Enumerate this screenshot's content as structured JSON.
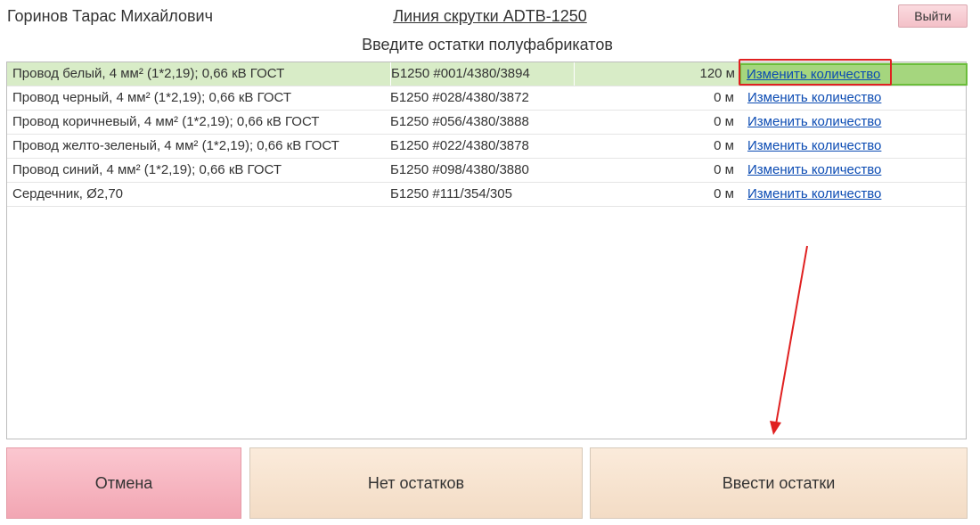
{
  "header": {
    "user_name": "Горинов Тарас Михайлович",
    "line_title": "Линия скрутки ADTB-1250",
    "logout_label": "Выйти"
  },
  "subtitle": "Введите остатки полуфабрикатов",
  "items": [
    {
      "name": "Провод белый, 4 мм² (1*2,19); 0,66 кВ ГОСТ",
      "code": "Б1250 #001/4380/3894",
      "qty": "120 м",
      "action": "Изменить количество",
      "selected": true
    },
    {
      "name": "Провод черный, 4 мм² (1*2,19); 0,66 кВ ГОСТ",
      "code": "Б1250 #028/4380/3872",
      "qty": "0 м",
      "action": "Изменить количество",
      "selected": false
    },
    {
      "name": "Провод коричневый, 4 мм² (1*2,19); 0,66 кВ ГОСТ",
      "code": "Б1250 #056/4380/3888",
      "qty": "0 м",
      "action": "Изменить количество",
      "selected": false
    },
    {
      "name": "Провод желто-зеленый, 4 мм² (1*2,19); 0,66 кВ ГОСТ",
      "code": "Б1250 #022/4380/3878",
      "qty": "0 м",
      "action": "Изменить количество",
      "selected": false
    },
    {
      "name": "Провод синий, 4 мм² (1*2,19); 0,66 кВ ГОСТ",
      "code": "Б1250 #098/4380/3880",
      "qty": "0 м",
      "action": "Изменить количество",
      "selected": false
    },
    {
      "name": "Сердечник, Ø2,70",
      "code": "Б1250 #111/354/305",
      "qty": "0 м",
      "action": "Изменить количество",
      "selected": false
    }
  ],
  "buttons": {
    "cancel": "Отмена",
    "no_remains": "Нет остатков",
    "submit": "Ввести остатки"
  },
  "colors": {
    "selected_row": "#d8ecc7",
    "selected_cell": "#a5d67e",
    "annotation": "#e02020",
    "link": "#0b4bb3"
  }
}
